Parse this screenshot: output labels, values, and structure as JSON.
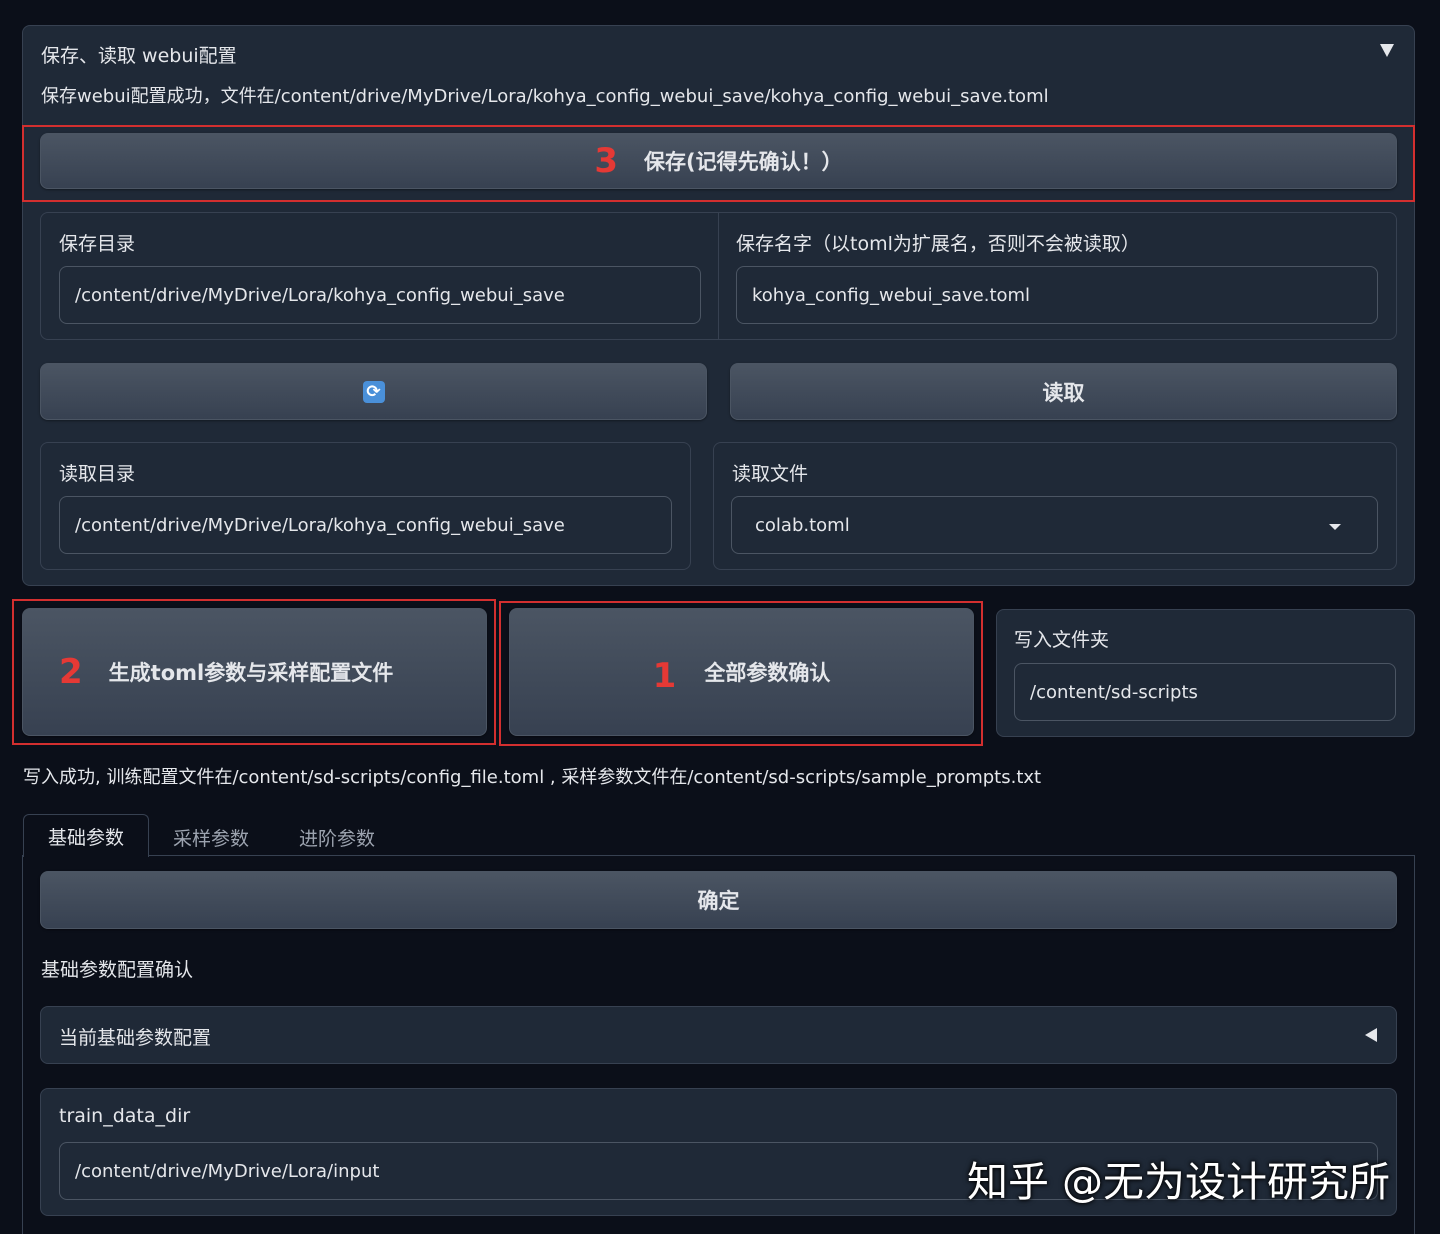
{
  "config_panel": {
    "title": "保存、读取 webui配置",
    "collapse_icon": "triangle-down-icon",
    "status": "保存webui配置成功，文件在/content/drive/MyDrive/Lora/kohya_config_webui_save/kohya_config_webui_save.toml",
    "save_button": {
      "marker": "3",
      "label": "保存(记得先确认！）"
    },
    "save_dir": {
      "label": "保存目录",
      "value": "/content/drive/MyDrive/Lora/kohya_config_webui_save"
    },
    "save_name": {
      "label": "保存名字（以toml为扩展名，否则不会被读取）",
      "value": "kohya_config_webui_save.toml"
    },
    "refresh_button_icon": "refresh-icon",
    "read_button": "读取",
    "read_dir": {
      "label": "读取目录",
      "value": "/content/drive/MyDrive/Lora/kohya_config_webui_save"
    },
    "read_file": {
      "label": "读取文件",
      "value": "colab.toml"
    }
  },
  "actions": {
    "generate": {
      "marker": "2",
      "label": "生成toml参数与采样配置文件"
    },
    "confirm_all": {
      "marker": "1",
      "label": "全部参数确认"
    },
    "write_folder": {
      "label": "写入文件夹",
      "value": "/content/sd-scripts"
    }
  },
  "write_status": "写入成功, 训练配置文件在/content/sd-scripts/config_file.toml , 采样参数文件在/content/sd-scripts/sample_prompts.txt",
  "tabs": [
    "基础参数",
    "采样参数",
    "进阶参数"
  ],
  "basic": {
    "confirm_button": "确定",
    "section_title": "基础参数配置确认",
    "accordion": {
      "label": "当前基础参数配置",
      "icon": "triangle-left-icon"
    },
    "train_data_dir": {
      "label": "train_data_dir",
      "value": "/content/drive/MyDrive/Lora/input"
    }
  },
  "watermark": "知乎 @无为设计研究所",
  "colors": {
    "background": "#0b0f19",
    "panel": "#1f2937",
    "button": "#4b5563",
    "highlight": "#d32f2f"
  }
}
